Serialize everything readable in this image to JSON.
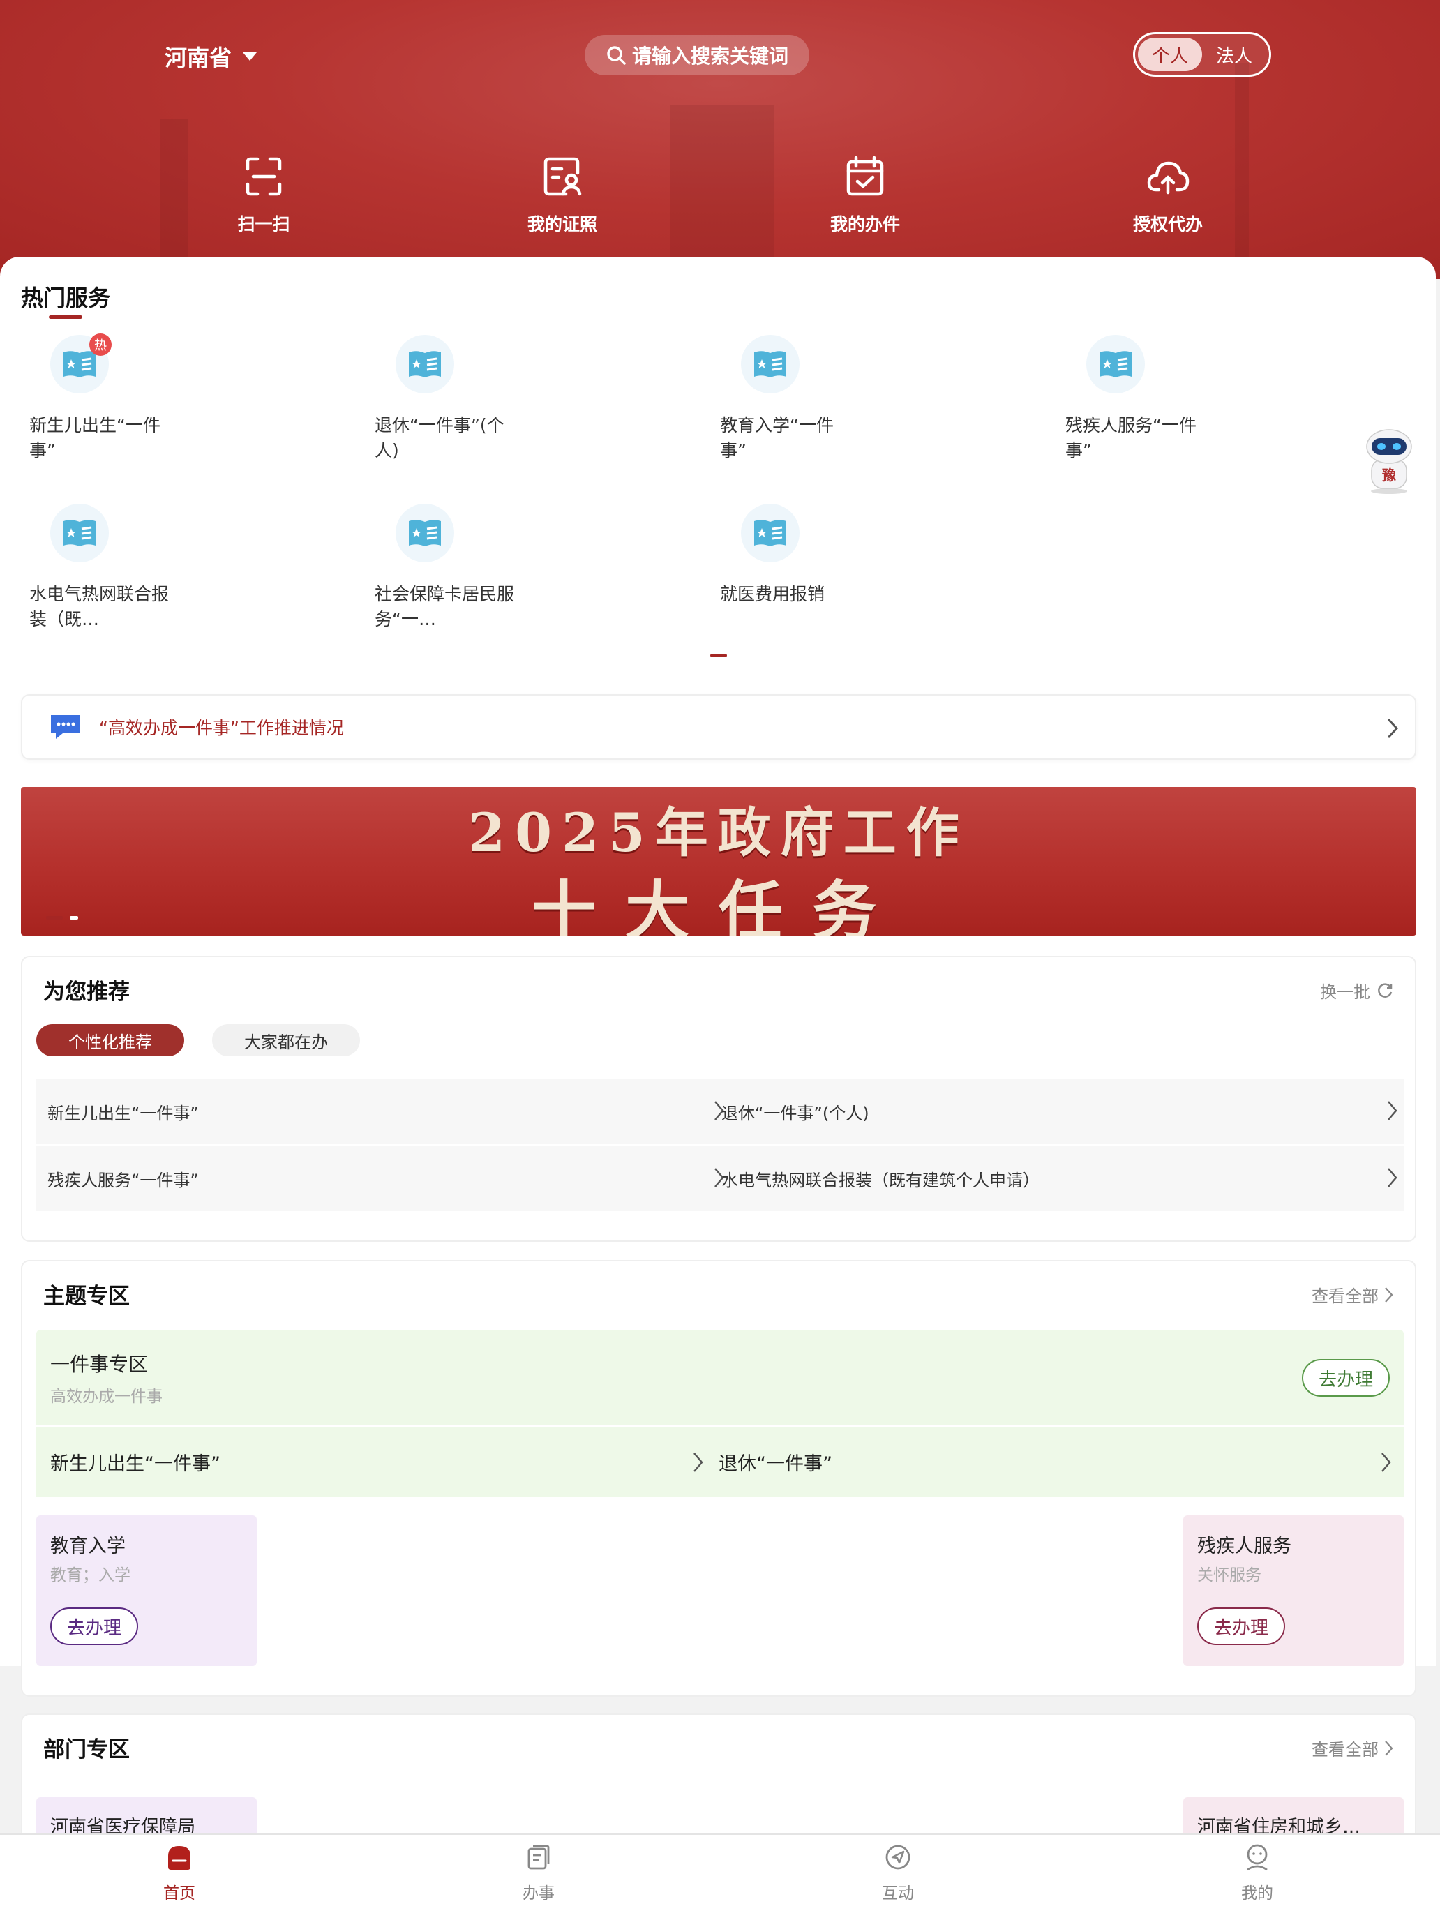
{
  "header": {
    "province": "河南省",
    "search_placeholder": "请输入搜索关键词",
    "toggle": {
      "personal": "个人",
      "legal": "法人",
      "active": "个人"
    },
    "quick_actions": [
      {
        "label": "扫一扫",
        "icon": "scan-icon"
      },
      {
        "label": "我的证照",
        "icon": "license-icon"
      },
      {
        "label": "我的办件",
        "icon": "calendar-check-icon"
      },
      {
        "label": "授权代办",
        "icon": "cloud-upload-icon"
      }
    ]
  },
  "hot_services": {
    "title": "热门服务",
    "hot_badge": "热",
    "items": [
      {
        "name": "新生儿出生“一件事”",
        "hot": true
      },
      {
        "name": "退休“一件事”(个人)"
      },
      {
        "name": "教育入学“一件事”"
      },
      {
        "name": "残疾人服务“一件事”"
      },
      {
        "name": "水电气热网联合报装（既…"
      },
      {
        "name": "社会保障卡居民服务“一…"
      },
      {
        "name": "就医费用报销"
      }
    ]
  },
  "robot": {
    "label": "豫"
  },
  "notice": {
    "text": "“高效办成一件事”工作推进情况"
  },
  "banner": {
    "line1": "2025年政府工作",
    "line2": "十大任务"
  },
  "recommend": {
    "title": "为您推荐",
    "refresh": "换一批",
    "tabs": [
      "个性化推荐",
      "大家都在办"
    ],
    "active_tab": "个性化推荐",
    "rows": [
      [
        "新生儿出生“一件事”",
        "退休“一件事”(个人)"
      ],
      [
        "残疾人服务“一件事”",
        "水电气热网联合报装（既有建筑个人申请）"
      ]
    ]
  },
  "theme": {
    "title": "主题专区",
    "view_all": "查看全部",
    "featured": {
      "name": "一件事专区",
      "subtitle": "高效办成一件事",
      "button": "去办理",
      "links": [
        "新生儿出生“一件事”",
        "退休“一件事”"
      ]
    },
    "cards": [
      {
        "name": "教育入学",
        "subtitle": "教育；入学",
        "button": "去办理",
        "bg": "#f3eaf9",
        "accent": "#5a2a82"
      },
      {
        "name": "残疾人服务",
        "subtitle": "关怀服务",
        "button": "去办理",
        "bg": "#f7e8ef",
        "accent": "#8a2a4a"
      }
    ]
  },
  "department": {
    "title": "部门专区",
    "view_all": "查看全部",
    "items": [
      "河南省医疗保障局",
      "河南省住房和城乡…"
    ]
  },
  "tabbar": [
    {
      "label": "首页",
      "icon": "home-icon",
      "active": true
    },
    {
      "label": "办事",
      "icon": "tasks-icon"
    },
    {
      "label": "互动",
      "icon": "interact-icon"
    },
    {
      "label": "我的",
      "icon": "profile-icon"
    }
  ],
  "colors": {
    "brand": "#a52624",
    "service_icon": "#4fb3d9",
    "green_bg": "#eef9e8"
  }
}
